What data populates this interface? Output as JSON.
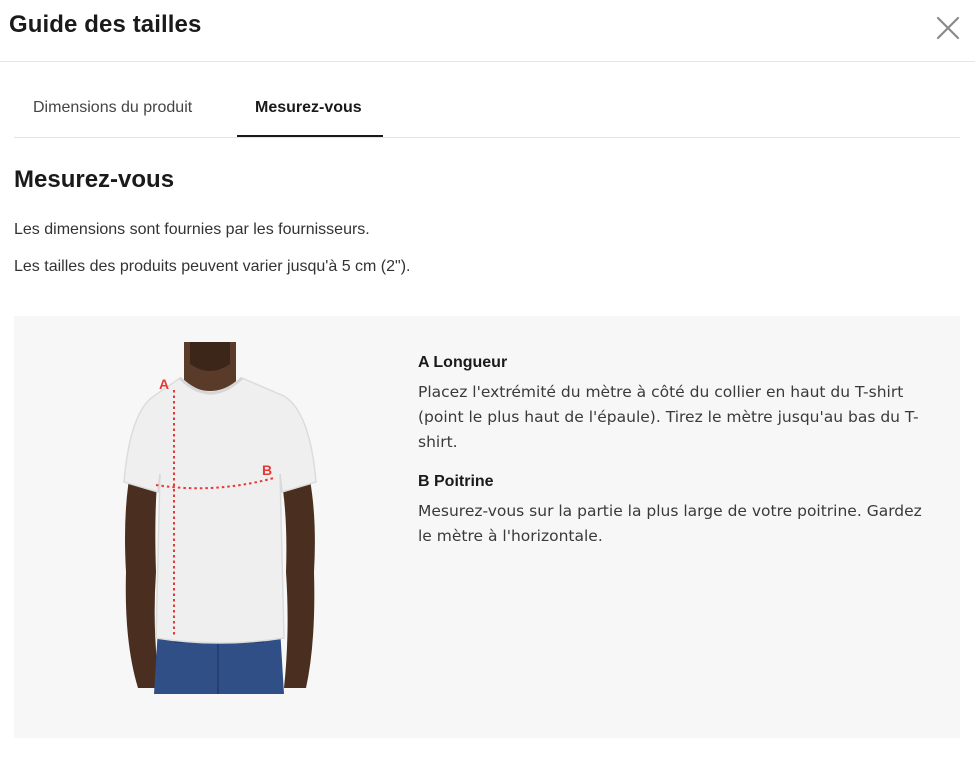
{
  "modal": {
    "title": "Guide des tailles",
    "close_icon": "close-icon"
  },
  "tabs": [
    {
      "label": "Dimensions du produit",
      "active": false
    },
    {
      "label": "Mesurez-vous",
      "active": true
    }
  ],
  "content": {
    "heading": "Mesurez-vous",
    "notes": [
      "Les dimensions sont fournies par les fournisseurs.",
      "Les tailles des produits peuvent varier jusqu'à 5 cm (2\")."
    ],
    "figure": {
      "label_a": "A",
      "label_b": "B"
    },
    "measures": [
      {
        "title": "A Longueur",
        "text": "Placez l'extrémité du mètre à côté du collier en haut du T-shirt (point le plus haut de l'épaule). Tirez le mètre jusqu'au bas du T-shirt."
      },
      {
        "title": "B Poitrine",
        "text": "Mesurez-vous sur la partie la plus large de votre poitrine. Gardez le mètre à l'horizontale."
      }
    ]
  },
  "colors": {
    "accent": "#1a1a1a",
    "panel_bg": "#f7f7f7",
    "measure_line": "#e53935"
  }
}
